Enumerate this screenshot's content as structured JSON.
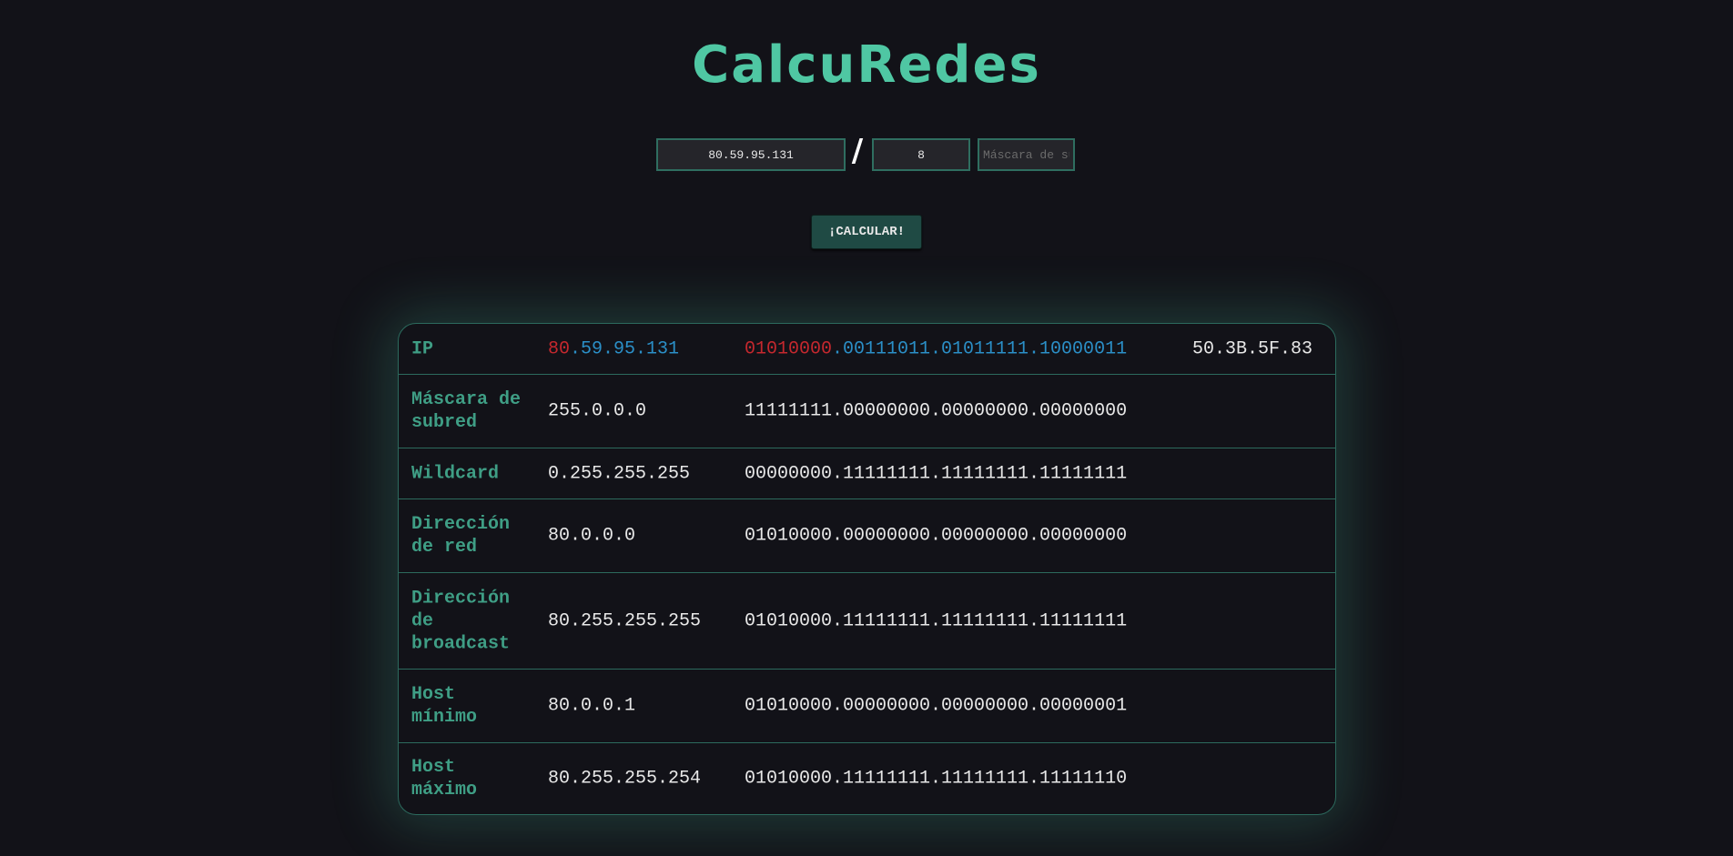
{
  "colors": {
    "accent": "#4fc7a3",
    "label": "#3f9e85",
    "text": "#e8e8e8",
    "network_part": "#c5282e",
    "host_part": "#2b8fc7",
    "button_bg": "#1f4a44",
    "background": "#121218"
  },
  "app": {
    "title": "CalcuRedes"
  },
  "form": {
    "ip_value": "80.59.95.131",
    "separator": "/",
    "cidr_value": "8",
    "mask_placeholder": "Máscara de subred",
    "calculate_label": "¡CALCULAR!"
  },
  "results": {
    "ip": {
      "label": "IP",
      "decimal_network": "80",
      "decimal_host": ".59.95.131",
      "binary_network": "01010000",
      "binary_host": ".00111011.01011111.10000011",
      "hex": "50.3B.5F.83"
    },
    "rows": [
      {
        "label": "Máscara de subred",
        "decimal": "255.0.0.0",
        "binary": "11111111.00000000.00000000.00000000"
      },
      {
        "label": "Wildcard",
        "decimal": "0.255.255.255",
        "binary": "00000000.11111111.11111111.11111111"
      },
      {
        "label": "Dirección de red",
        "decimal": "80.0.0.0",
        "binary": "01010000.00000000.00000000.00000000"
      },
      {
        "label": "Dirección de broadcast",
        "decimal": "80.255.255.255",
        "binary": "01010000.11111111.11111111.11111111"
      },
      {
        "label": "Host mínimo",
        "decimal": "80.0.0.1",
        "binary": "01010000.00000000.00000000.00000001"
      },
      {
        "label": "Host máximo",
        "decimal": "80.255.255.254",
        "binary": "01010000.11111111.11111111.11111110"
      }
    ]
  }
}
